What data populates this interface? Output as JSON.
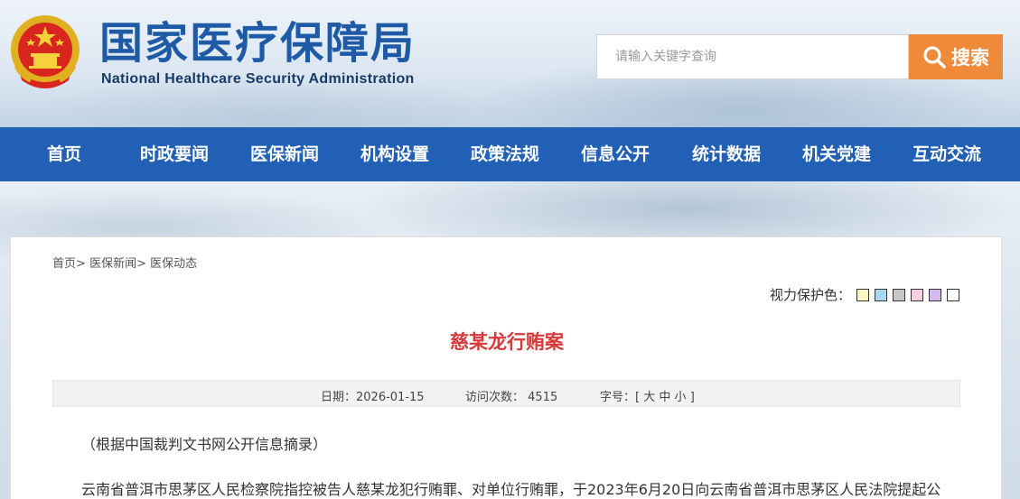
{
  "header": {
    "title_cn": "国家医疗保障局",
    "title_en": "National Healthcare Security Administration",
    "emblem_icon": "national-emblem-icon"
  },
  "search": {
    "placeholder": "请输入关键字查询",
    "button_label": "搜索",
    "button_color": "#ef8a3a",
    "icon": "search-icon"
  },
  "nav": {
    "color": "#2160b4",
    "items": [
      {
        "label": "首页"
      },
      {
        "label": "时政要闻"
      },
      {
        "label": "医保新闻"
      },
      {
        "label": "机构设置"
      },
      {
        "label": "政策法规"
      },
      {
        "label": "信息公开"
      },
      {
        "label": "统计数据"
      },
      {
        "label": "机关党建"
      },
      {
        "label": "互动交流"
      }
    ]
  },
  "breadcrumb": {
    "items": [
      "首页",
      "医保新闻",
      "医保动态"
    ],
    "separator": ">"
  },
  "eye_protect": {
    "label": "视力保护色：",
    "swatches": [
      "#fbf7c4",
      "#a9d8f3",
      "#c8c8c8",
      "#f7cfe0",
      "#d7b8f0",
      "#ffffff"
    ]
  },
  "article": {
    "title": "慈某龙行贿案",
    "title_color": "#d8393a",
    "meta": {
      "date_label": "日期：",
      "date": "2026-01-15",
      "views_label": "访问次数：",
      "views": "4515",
      "fontsize_label": "字号：",
      "fontsize_open": "[",
      "fontsize_large": "大",
      "fontsize_medium": "中",
      "fontsize_small": "小",
      "fontsize_close": "]"
    },
    "paragraphs": [
      "（根据中国裁判文书网公开信息摘录）",
      "云南省普洱市思茅区人民检察院指控被告人慈某龙犯行贿罪、对单位行贿罪，于2023年6月20日向云南省普洱市思茅区人民法院提起公"
    ]
  }
}
